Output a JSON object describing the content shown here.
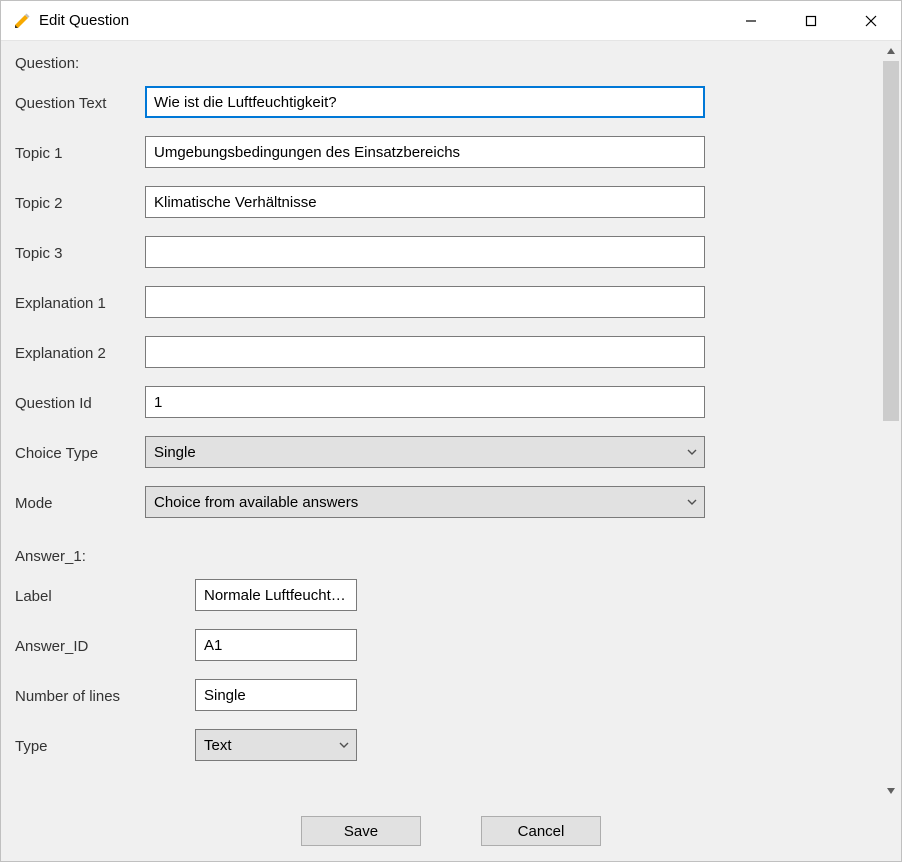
{
  "window": {
    "title": "Edit Question"
  },
  "question": {
    "section_label": "Question:",
    "fields": {
      "question_text": {
        "label": "Question Text",
        "value": "Wie ist die Luftfeuchtigkeit?"
      },
      "topic1": {
        "label": "Topic 1",
        "value": "Umgebungsbedingungen des Einsatzbereichs"
      },
      "topic2": {
        "label": "Topic 2",
        "value": "Klimatische Verhältnisse"
      },
      "topic3": {
        "label": "Topic 3",
        "value": ""
      },
      "explanation1": {
        "label": "Explanation 1",
        "value": ""
      },
      "explanation2": {
        "label": "Explanation 2",
        "value": ""
      },
      "question_id": {
        "label": "Question Id",
        "value": "1"
      },
      "choice_type": {
        "label": "Choice Type",
        "value": "Single"
      },
      "mode": {
        "label": "Mode",
        "value": "Choice from available answers"
      }
    }
  },
  "answer": {
    "section_label": "Answer_1:",
    "fields": {
      "label": {
        "label": "Label",
        "value": "Normale Luftfeuchtigkeit"
      },
      "answer_id": {
        "label": "Answer_ID",
        "value": "A1"
      },
      "number_of_lines": {
        "label": "Number of lines",
        "value": "Single"
      },
      "type": {
        "label": "Type",
        "value": "Text"
      }
    }
  },
  "buttons": {
    "save": "Save",
    "cancel": "Cancel"
  }
}
